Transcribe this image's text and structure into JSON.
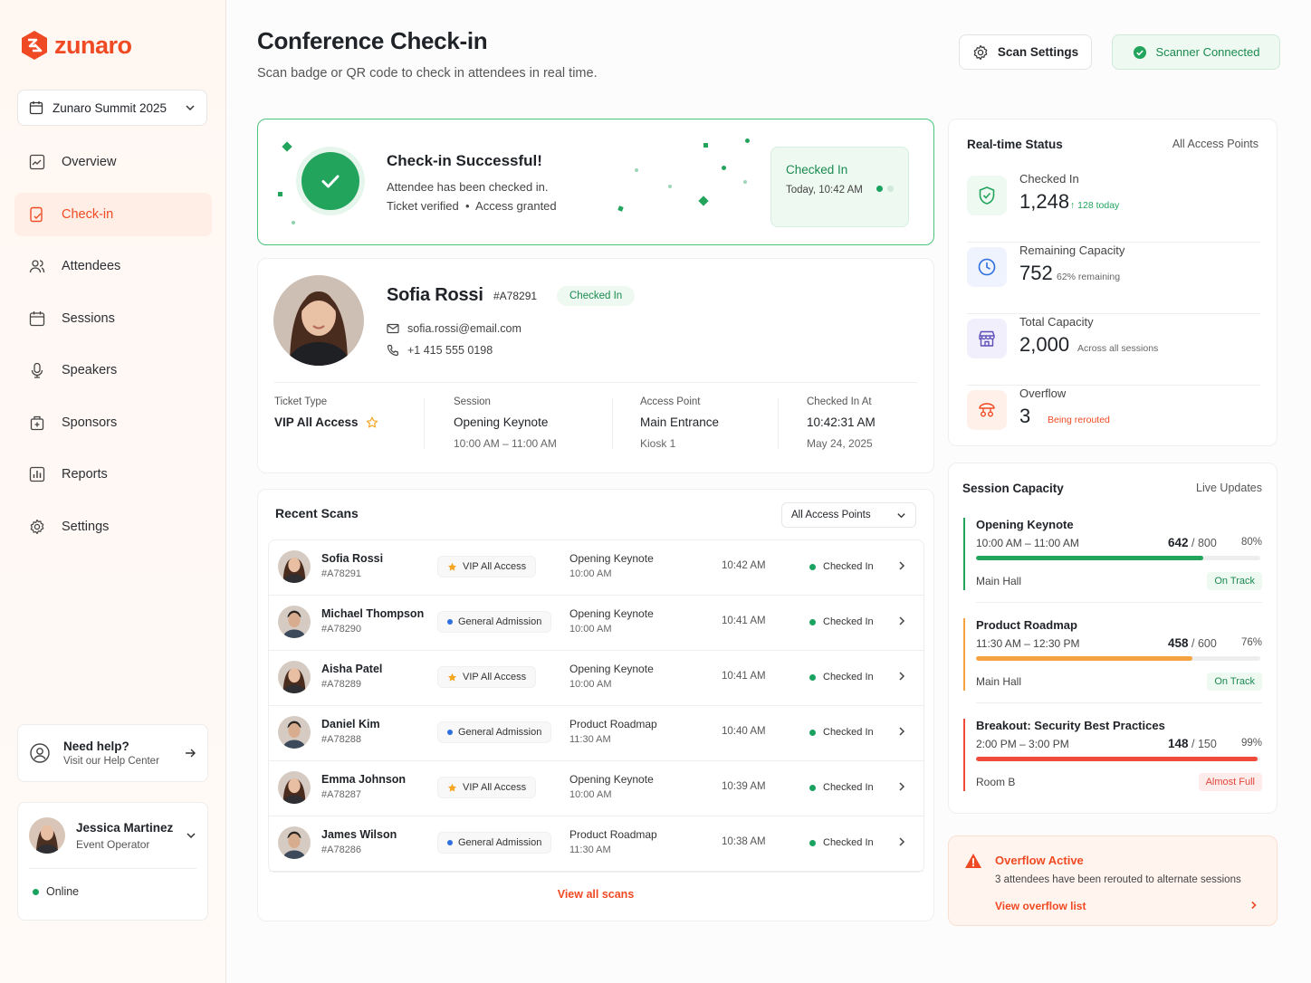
{
  "brand": {
    "name": "zunaro",
    "accent": "#ef4a23",
    "success": "#22a45d"
  },
  "event_select": {
    "value": "Zunaro Summit 2025"
  },
  "nav": [
    {
      "label": "Overview",
      "icon": "overview-icon",
      "active": false
    },
    {
      "label": "Check-in",
      "icon": "checkin-icon",
      "active": true
    },
    {
      "label": "Attendees",
      "icon": "users-icon",
      "active": false
    },
    {
      "label": "Sessions",
      "icon": "calendar-icon",
      "active": false
    },
    {
      "label": "Speakers",
      "icon": "microphone-icon",
      "active": false
    },
    {
      "label": "Sponsors",
      "icon": "sponsor-icon",
      "active": false
    },
    {
      "label": "Reports",
      "icon": "reports-icon",
      "active": false
    },
    {
      "label": "Settings",
      "icon": "gear-icon",
      "active": false
    }
  ],
  "help": {
    "title": "Need help?",
    "subtitle": "Visit our Help Center"
  },
  "user": {
    "name": "Jessica Martinez",
    "role": "Event Operator",
    "status": "Online"
  },
  "header": {
    "title": "Conference Check-in",
    "subtitle": "Scan badge or QR code to check in attendees in real time.",
    "scan_settings": "Scan Settings",
    "scanner_status": "Scanner Connected"
  },
  "success": {
    "title": "Check-in Successful!",
    "line1": "Attendee has been checked in.",
    "verified": "Ticket verified",
    "granted": "Access granted",
    "badge_title": "Checked In",
    "badge_time": "Today, 10:42 AM"
  },
  "attendee": {
    "name": "Sofia Rossi",
    "id": "#A78291",
    "status": "Checked In",
    "email": "sofia.rossi@email.com",
    "phone": "+1 415 555 0198",
    "ticket_label": "Ticket Type",
    "ticket_value": "VIP All Access",
    "session_label": "Session",
    "session_value": "Opening Keynote",
    "session_time": "10:00 AM – 11:00 AM",
    "access_label": "Access Point",
    "access_value": "Main Entrance",
    "access_sub": "Kiosk 1",
    "checked_label": "Checked In At",
    "checked_value": "10:42:31 AM",
    "checked_date": "May 24, 2025"
  },
  "recent": {
    "title": "Recent Scans",
    "filter": "All Access Points",
    "view_all": "View all scans",
    "rows": [
      {
        "name": "Sofia Rossi",
        "id": "#A78291",
        "ticket": "VIP All Access",
        "vip": true,
        "session": "Opening Keynote",
        "stime": "10:00 AM",
        "time": "10:42 AM",
        "status": "Checked In",
        "g": "f"
      },
      {
        "name": "Michael Thompson",
        "id": "#A78290",
        "ticket": "General Admission",
        "vip": false,
        "session": "Opening Keynote",
        "stime": "10:00 AM",
        "time": "10:41 AM",
        "status": "Checked In",
        "g": "m"
      },
      {
        "name": "Aisha Patel",
        "id": "#A78289",
        "ticket": "VIP All Access",
        "vip": true,
        "session": "Opening Keynote",
        "stime": "10:00 AM",
        "time": "10:41 AM",
        "status": "Checked In",
        "g": "f"
      },
      {
        "name": "Daniel Kim",
        "id": "#A78288",
        "ticket": "General Admission",
        "vip": false,
        "session": "Product Roadmap",
        "stime": "11:30 AM",
        "time": "10:40 AM",
        "status": "Checked In",
        "g": "m"
      },
      {
        "name": "Emma Johnson",
        "id": "#A78287",
        "ticket": "VIP All Access",
        "vip": true,
        "session": "Opening Keynote",
        "stime": "10:00 AM",
        "time": "10:39 AM",
        "status": "Checked In",
        "g": "f"
      },
      {
        "name": "James Wilson",
        "id": "#A78286",
        "ticket": "General Admission",
        "vip": false,
        "session": "Product Roadmap",
        "stime": "11:30 AM",
        "time": "10:38 AM",
        "status": "Checked In",
        "g": "m"
      }
    ]
  },
  "realtime": {
    "title": "Real-time Status",
    "scope": "All Access Points",
    "stats": [
      {
        "label": "Checked In",
        "value": "1,248",
        "note": "↑ 128 today",
        "tone": "green"
      },
      {
        "label": "Remaining Capacity",
        "value": "752",
        "note": "62% remaining",
        "tone": "blue"
      },
      {
        "label": "Total Capacity",
        "value": "2,000",
        "note": "Across all sessions",
        "tone": "purple"
      },
      {
        "label": "Overflow",
        "value": "3",
        "note": "Being rerouted",
        "tone": "orange"
      }
    ]
  },
  "capacity": {
    "title": "Session Capacity",
    "mode": "Live Updates",
    "sessions": [
      {
        "name": "Opening Keynote",
        "time": "10:00 AM – 11:00 AM",
        "count": "642",
        "total": "/ 800",
        "pct": "80%",
        "fill": 0.8,
        "room": "Main Hall",
        "tag": "On Track",
        "color": "#22a45d"
      },
      {
        "name": "Product Roadmap",
        "time": "11:30 AM – 12:30 PM",
        "count": "458",
        "total": "/ 600",
        "pct": "76%",
        "fill": 0.76,
        "room": "Main Hall",
        "tag": "On Track",
        "color": "#f5a340"
      },
      {
        "name": "Breakout: Security Best Practices",
        "time": "2:00 PM – 3:00 PM",
        "count": "148",
        "total": "/ 150",
        "pct": "99%",
        "fill": 0.99,
        "room": "Room B",
        "tag": "Almost Full",
        "color": "#ef4a3a"
      }
    ]
  },
  "overflow": {
    "title": "Overflow Active",
    "desc": "3 attendees have been rerouted to alternate sessions",
    "link": "View overflow list"
  }
}
